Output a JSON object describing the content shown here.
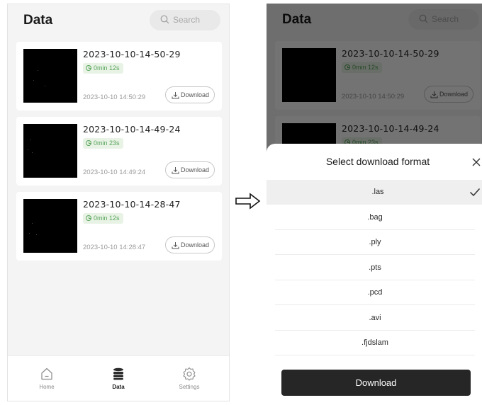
{
  "app": {
    "title": "Data"
  },
  "search": {
    "placeholder": "Search"
  },
  "recordings": [
    {
      "name": "2023-10-10-14-50-29",
      "duration": "0min 12s",
      "date": "2023-10-10 14:50:29",
      "download_label": "Download"
    },
    {
      "name": "2023-10-10-14-49-24",
      "duration": "0min 23s",
      "date": "2023-10-10 14:49:24",
      "download_label": "Download"
    },
    {
      "name": "2023-10-10-14-28-47",
      "duration": "0min 12s",
      "date": "2023-10-10 14:28:47",
      "download_label": "Download"
    }
  ],
  "tabbar": [
    {
      "label": "Home",
      "icon": "home-icon",
      "active": false
    },
    {
      "label": "Data",
      "icon": "database-icon",
      "active": true
    },
    {
      "label": "Settings",
      "icon": "gear-icon",
      "active": false
    }
  ],
  "download_sheet": {
    "title": "Select download format",
    "options": [
      ".las",
      ".bag",
      ".ply",
      ".pts",
      ".pcd",
      ".avi",
      ".fjdslam"
    ],
    "selected": ".las",
    "download_button": "Download"
  },
  "colors": {
    "accent_dark": "#262626",
    "duration_badge_text": "#58a45a",
    "duration_badge_bg": "#e8f3e6",
    "page_background": "#f4f4f4"
  },
  "icons": {
    "search": "search-icon",
    "download": "download-icon",
    "clock": "clock-icon",
    "close": "close-icon",
    "check": "check-icon",
    "arrow": "right-arrow-icon"
  }
}
